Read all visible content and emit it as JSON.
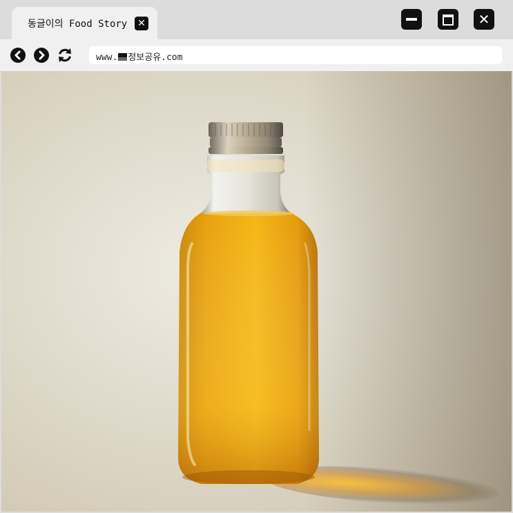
{
  "browser": {
    "tab": {
      "title": "동글이의 Food Story",
      "close_icon": "close-icon"
    },
    "window_controls": {
      "minimize_icon": "minimize-icon",
      "maximize_icon": "maximize-icon",
      "close_icon": "close-icon",
      "close_glyph": "✕"
    },
    "nav": {
      "back_icon": "chevron-left-icon",
      "forward_icon": "chevron-right-icon",
      "reload_icon": "reload-icon"
    },
    "address": {
      "prefix": "www.",
      "domain": "정보공유.com"
    }
  },
  "content": {
    "image_subject": "glass bottle of golden oil",
    "colors": {
      "oil": "#e8a00a",
      "cap": "#b8a888",
      "background": "#e3ddd0"
    }
  }
}
